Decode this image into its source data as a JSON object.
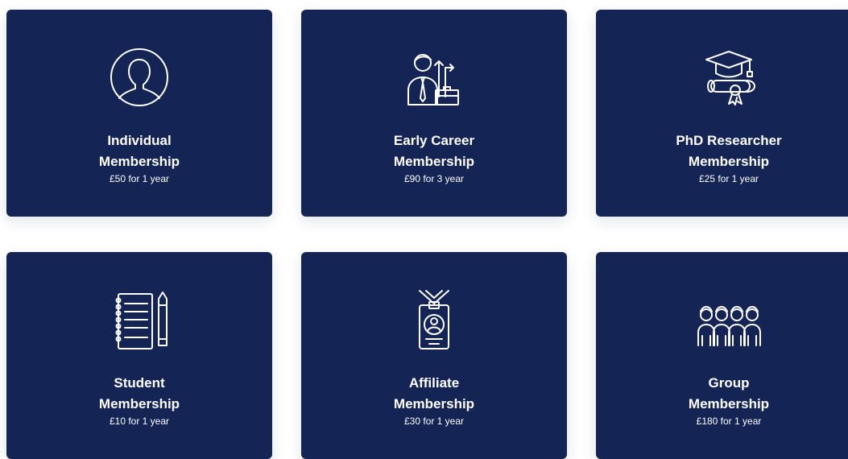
{
  "cards": [
    {
      "icon": "person-icon",
      "title1": "Individual",
      "title2": "Membership",
      "price": "£50 for 1 year"
    },
    {
      "icon": "career-briefcase-icon",
      "title1": "Early Career",
      "title2": "Membership",
      "price": "£90 for 3 year"
    },
    {
      "icon": "graduation-cap-diploma-icon",
      "title1": "PhD Researcher",
      "title2": "Membership",
      "price": "£25 for 1 year"
    },
    {
      "icon": "notebook-pencil-icon",
      "title1": "Student",
      "title2": "Membership",
      "price": "£10 for 1 year"
    },
    {
      "icon": "id-badge-icon",
      "title1": "Affiliate",
      "title2": "Membership",
      "price": "£30 for 1 year"
    },
    {
      "icon": "group-people-icon",
      "title1": "Group",
      "title2": "Membership",
      "price": "£180 for 1 year"
    }
  ],
  "colors": {
    "card_background": "#132455",
    "text": "#ffffff",
    "page_background": "#ffffff"
  }
}
